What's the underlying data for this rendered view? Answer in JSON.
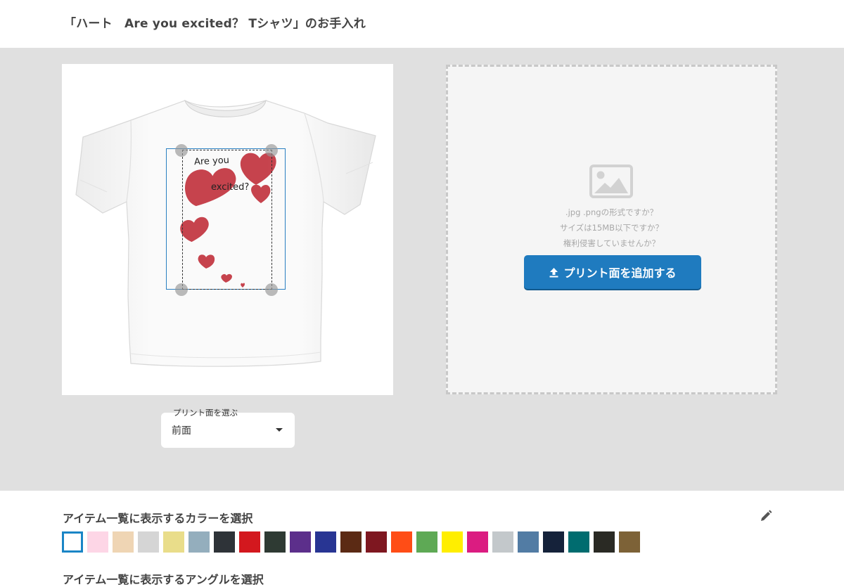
{
  "header": {
    "title": "「ハート　Are you excited？ Tシャツ」のお手入れ"
  },
  "preview": {
    "print_text_line1": "Are you",
    "print_text_line2": "excited?"
  },
  "side_select": {
    "legend": "プリント面を選ぶ",
    "value": "前面"
  },
  "upload": {
    "hint_1": ".jpg .pngの形式ですか？",
    "hint_2": "サイズは15MB以下ですか？",
    "hint_3": "権利侵害していませんか？",
    "button_label": "プリント面を追加する",
    "icon": "upload-icon"
  },
  "colors": {
    "title": "アイテム一覧に表示するカラーを選択",
    "next_title": "アイテム一覧に表示するアングルを選択",
    "edit_icon": "pencil-icon",
    "swatches": [
      {
        "name": "white",
        "hex": "#ffffff",
        "selected": true
      },
      {
        "name": "light-pink",
        "hex": "#fdd6e6"
      },
      {
        "name": "natural",
        "hex": "#efd5b4"
      },
      {
        "name": "ash",
        "hex": "#d5d5d5"
      },
      {
        "name": "light-yellow",
        "hex": "#e9dd8a"
      },
      {
        "name": "acid-blue",
        "hex": "#94aebd"
      },
      {
        "name": "charcoal",
        "hex": "#2e3338"
      },
      {
        "name": "red",
        "hex": "#d3181e"
      },
      {
        "name": "forest",
        "hex": "#2e3a33"
      },
      {
        "name": "purple",
        "hex": "#5c2f8b"
      },
      {
        "name": "royal-blue",
        "hex": "#283593"
      },
      {
        "name": "chocolate",
        "hex": "#5b2a14"
      },
      {
        "name": "burgundy",
        "hex": "#7e1720"
      },
      {
        "name": "orange",
        "hex": "#ff4d16"
      },
      {
        "name": "green",
        "hex": "#5ea955"
      },
      {
        "name": "yellow",
        "hex": "#ffee00"
      },
      {
        "name": "hot-pink",
        "hex": "#db1c81"
      },
      {
        "name": "silver-gray",
        "hex": "#c3c8cb"
      },
      {
        "name": "denim",
        "hex": "#527ca4"
      },
      {
        "name": "navy",
        "hex": "#15223a"
      },
      {
        "name": "teal",
        "hex": "#006c6f"
      },
      {
        "name": "black",
        "hex": "#2a2a24"
      },
      {
        "name": "olive-brown",
        "hex": "#7d6237"
      }
    ]
  }
}
